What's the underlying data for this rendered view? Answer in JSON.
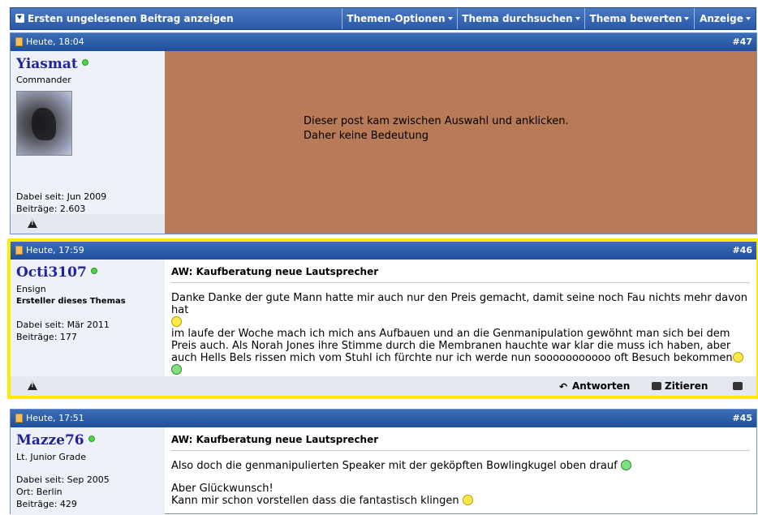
{
  "toolbar": {
    "first_unread": "Ersten ungelesenen Beitrag anzeigen",
    "menus": [
      "Themen-Optionen",
      "Thema durchsuchen",
      "Thema bewerten",
      "Anzeige"
    ]
  },
  "posts": [
    {
      "date": "Heute, 18:04",
      "number": "#47",
      "username": "Yiasmat",
      "rank": "Commander",
      "joined": "Dabei seit: Jun 2009",
      "posts_count": "Beiträge: 2.603",
      "content_lines": [
        "Dieser post kam zwischen Auswahl und anklicken.",
        "Daher keine Bedeutung"
      ]
    },
    {
      "date": "Heute, 17:59",
      "number": "#46",
      "username": "Octi3107",
      "rank": "Ensign",
      "starter": "Ersteller dieses Themas",
      "joined": "Dabei seit: Mär 2011",
      "posts_count": "Beiträge: 177",
      "title": "AW: Kaufberatung neue Lautsprecher",
      "para1": "Danke Danke der gute Mann hatte mir auch nur den Preis gemacht, damit seine noch Fau nichts mehr davon hat",
      "para2": "im laufe der Woche mach ich mich ans Aufbauen und an die Genmanipulation gewöhnt man sich bei dem Preis auch. Als Norah Jones ihre Stimme durch die Membranen hauchte war klar die muss ich haben, aber auch Hells Bels rissen mich vom Stuhl ich fürchte nur ich werde nun sooooooooooo oft Besuch bekommen",
      "reply": "Antworten",
      "quote": "Zitieren"
    },
    {
      "date": "Heute, 17:51",
      "number": "#45",
      "username": "Mazze76",
      "rank": "Lt. Junior Grade",
      "joined": "Dabei seit: Sep 2005",
      "location": "Ort: Berlin",
      "posts_count": "Beiträge: 429",
      "title": "AW: Kaufberatung neue Lautsprecher",
      "para1": "Also doch die genmanipulierten Speaker mit der geköpften Bowlingkugel oben drauf",
      "para2a": "Aber Glückwunsch!",
      "para2b": "Kann mir schon vorstellen dass die fantastisch klingen"
    }
  ]
}
